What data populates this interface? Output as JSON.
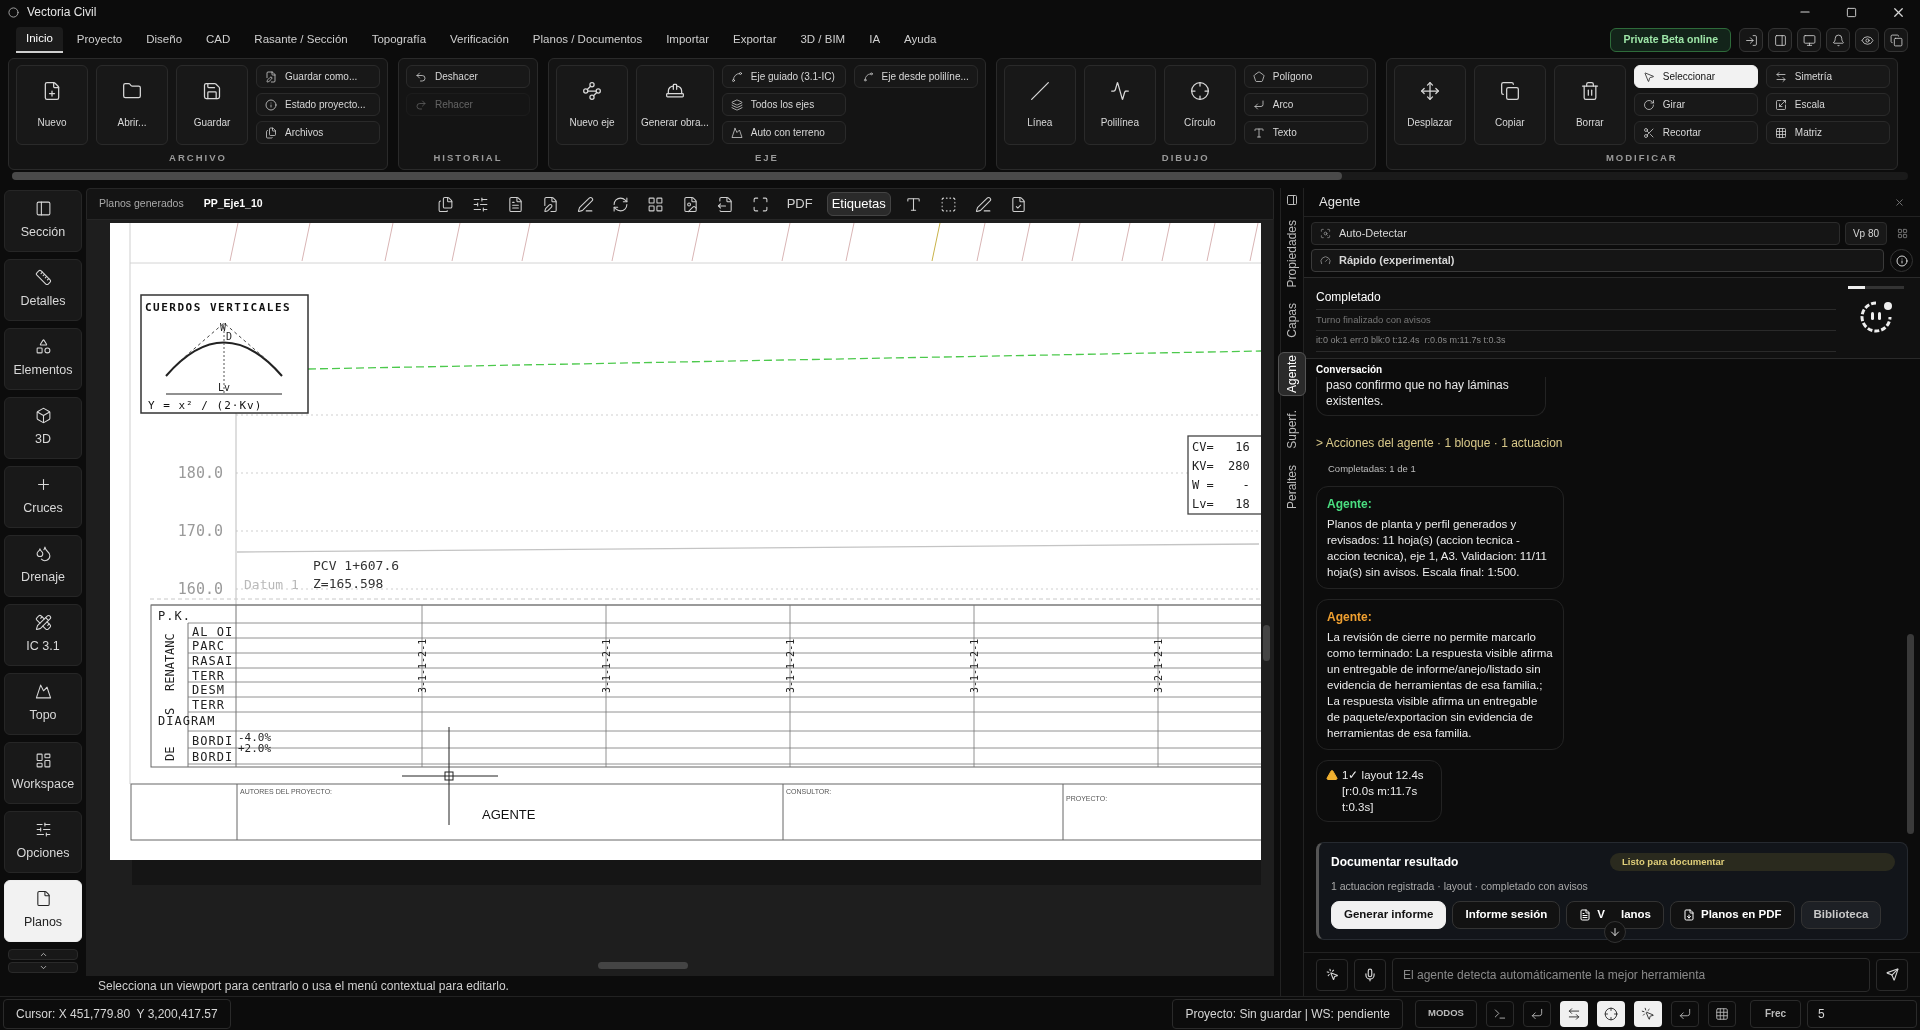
{
  "window": {
    "title": "Vectoria Civil"
  },
  "menu_tabs": [
    {
      "label": "Inicio",
      "selected": true
    },
    {
      "label": "Proyecto",
      "selected": false
    },
    {
      "label": "Diseño",
      "selected": false
    },
    {
      "label": "CAD",
      "selected": false
    },
    {
      "label": "Rasante / Sección",
      "selected": false
    },
    {
      "label": "Topografía",
      "selected": false
    },
    {
      "label": "Verificación",
      "selected": false
    },
    {
      "label": "Planos / Documentos",
      "selected": false
    },
    {
      "label": "Importar",
      "selected": false
    },
    {
      "label": "Exportar",
      "selected": false
    },
    {
      "label": "3D / BIM",
      "selected": false
    },
    {
      "label": "IA",
      "selected": false
    },
    {
      "label": "Ayuda",
      "selected": false
    }
  ],
  "status_badge": "Private Beta online",
  "ribbon": {
    "groups": [
      {
        "title": "ARCHIVO",
        "large": [
          {
            "label": "Nuevo"
          },
          {
            "label": "Abrir..."
          },
          {
            "label": "Guardar"
          }
        ],
        "small_columns": [
          [
            {
              "label": "Guardar como...",
              "disabled": false,
              "selected": false
            },
            {
              "label": "Estado proyecto...",
              "disabled": false,
              "selected": false
            },
            {
              "label": "Archivos",
              "disabled": false,
              "selected": false
            }
          ]
        ]
      },
      {
        "title": "HISTORIAL",
        "small_columns": [
          [
            {
              "label": "Deshacer",
              "disabled": false,
              "selected": false
            },
            {
              "label": "Rehacer",
              "disabled": true,
              "selected": false
            }
          ]
        ]
      },
      {
        "title": "EJE",
        "large": [
          {
            "label": "Nuevo eje"
          },
          {
            "label": "Generar obra..."
          }
        ],
        "small_columns": [
          [
            {
              "label": "Eje guiado (3.1-IC)",
              "disabled": false,
              "selected": false
            },
            {
              "label": "Todos los ejes",
              "disabled": false,
              "selected": false
            },
            {
              "label": "Auto con terreno",
              "disabled": false,
              "selected": false
            }
          ],
          [
            {
              "label": "Eje desde polilíne...",
              "disabled": false,
              "selected": false
            }
          ]
        ]
      },
      {
        "title": "DIBUJO",
        "large": [
          {
            "label": "Línea"
          },
          {
            "label": "Polilínea"
          },
          {
            "label": "Círculo"
          }
        ],
        "small_columns": [
          [
            {
              "label": "Polígono",
              "disabled": false,
              "selected": false
            },
            {
              "label": "Arco",
              "disabled": false,
              "selected": false
            },
            {
              "label": "Texto",
              "disabled": false,
              "selected": false
            }
          ]
        ]
      },
      {
        "title": "MODIFICAR",
        "large": [
          {
            "label": "Desplazar"
          },
          {
            "label": "Copiar"
          },
          {
            "label": "Borrar"
          }
        ],
        "small_columns": [
          [
            {
              "label": "Seleccionar",
              "disabled": false,
              "selected": true
            },
            {
              "label": "Girar",
              "disabled": false,
              "selected": false
            },
            {
              "label": "Recortar",
              "disabled": false,
              "selected": false
            }
          ],
          [
            {
              "label": "Simetría",
              "disabled": false,
              "selected": false
            },
            {
              "label": "Escala",
              "disabled": false,
              "selected": false
            },
            {
              "label": "Matriz",
              "disabled": false,
              "selected": false
            }
          ]
        ]
      }
    ]
  },
  "sidebar": {
    "items": [
      {
        "label": "Sección",
        "selected": false
      },
      {
        "label": "Detalles",
        "selected": false
      },
      {
        "label": "Elementos",
        "selected": false
      },
      {
        "label": "3D",
        "selected": false
      },
      {
        "label": "Cruces",
        "selected": false
      },
      {
        "label": "Drenaje",
        "selected": false
      },
      {
        "label": "IC 3.1",
        "selected": false
      },
      {
        "label": "Topo",
        "selected": false
      },
      {
        "label": "Workspace",
        "selected": false
      },
      {
        "label": "Opciones",
        "selected": false
      },
      {
        "label": "Planos",
        "selected": true
      }
    ]
  },
  "viewer": {
    "breadcrumb": "Planos generados",
    "sheet_name": "PP_Eje1_10",
    "text_buttons": [
      {
        "label": "PDF",
        "selected": false
      },
      {
        "label": "Etiquetas",
        "selected": true
      }
    ],
    "hint": "Selecciona un viewport para centrarlo o usa el menú contextual para editarlo."
  },
  "drawing": {
    "detail_box": {
      "title": "CUERDOS VERTICALES",
      "apex_label": "W",
      "offset_label": "D",
      "length_label": "Lv",
      "formula": "Y = x² / (2·Kv)"
    },
    "axis_labels": [
      "180.0",
      "170.0",
      "160.0"
    ],
    "datum": "Datum 1",
    "pcv": {
      "station": "PCV 1+607.6",
      "elevation": "Z=165.598"
    },
    "curve_data": [
      "CV=   16",
      "KV=  280",
      "W =    -",
      "Lv=   18"
    ],
    "band_groups": [
      "RENATANC",
      "S",
      "DE"
    ],
    "band_rows": [
      "P.K.",
      "AL OI",
      "PARC",
      "RASAI",
      "TERR",
      "DESM",
      "TERR",
      "DIAGRAM",
      "BORDI",
      "BORDI"
    ],
    "stations": [
      "3-1-1-2-1",
      "3-1-1-2-1",
      "3-1-1-2-1",
      "3-1-1-2-1",
      "3-2-1-2-1"
    ],
    "grades": [
      "-4.0%",
      "+2.0%"
    ],
    "title_block": {
      "authors_label": "AUTORES DEL PROYECTO:",
      "authors": "AGENTE",
      "consultant_label": "CONSULTOR:",
      "project_label": "PROYECTO:"
    }
  },
  "side_tabs": [
    {
      "label": "Propiedades",
      "selected": false
    },
    {
      "label": "Capas",
      "selected": false
    },
    {
      "label": "Agente",
      "selected": true
    },
    {
      "label": "Superf.",
      "selected": false
    },
    {
      "label": "Peraltes",
      "selected": false
    }
  ],
  "agent_panel": {
    "title": "Agente",
    "detector": "Auto-Detectar",
    "viewport_button": "Vp 80",
    "mode": "Rápido (experimental)",
    "run_status": {
      "title": "Completado",
      "subtitle": "Turno finalizado con avisos",
      "metrics": "it:0 ok:1 err:0 blk:0 t:12.4s  r:0.0s m:11.7s t:0.3s",
      "level": 0.3
    },
    "conversation_label": "Conversación",
    "messages": [
      {
        "kind": "text",
        "text": "paso confirmo que no hay láminas existentes."
      },
      {
        "kind": "actions",
        "text": "> Acciones del agente · 1 bloque · 1 actuacion"
      },
      {
        "kind": "note",
        "text": "Completadas: 1 de 1"
      },
      {
        "kind": "agent",
        "author": "Agente:",
        "color": "#4ade80",
        "text": "Planos de planta y perfil generados y revisados: 11 hoja(s) (accion tecnica - accion tecnica), eje 1, A3. Validacion: 11/11 hoja(s) sin avisos. Escala final: 1:500."
      },
      {
        "kind": "agent",
        "author": "Agente:",
        "color": "#f0a030",
        "text": "La revisión de cierre no permite marcarlo como terminado: La respuesta visible afirma un entregable de informe/anejo/listado sin evidencia de herramientas de esa familia.; La respuesta visible afirma un entregable de paquete/exportacion sin evidencia de herramientas de esa familia."
      },
      {
        "kind": "metrics",
        "text": "1✓ layout 12.4s [r:0.0s m:11.7s t:0.3s]"
      }
    ],
    "document_card": {
      "title": "Documentar resultado",
      "badge": "Listo para documentar",
      "summary": "1 actuacion registrada · layout · completado con avisos",
      "buttons": [
        {
          "label": "Generar informe",
          "kind": "primary"
        },
        {
          "label": "Informe sesión",
          "kind": "plain"
        },
        {
          "label": "V     lanos",
          "kind": "file"
        },
        {
          "label": "Planos en PDF",
          "kind": "pdf"
        },
        {
          "label": "Biblioteca",
          "kind": "muted"
        }
      ]
    },
    "input": {
      "placeholder": "El agente detecta automáticamente la mejor herramienta"
    }
  },
  "status_bar": {
    "cursor": "Cursor: X 451,779.80  Y 3,200,417.57",
    "project": "Proyecto: Sin guardar | WS: pendiente",
    "modes_button": "MODOS",
    "snap_toggles": [
      {
        "on": false
      },
      {
        "on": false
      },
      {
        "on": true
      },
      {
        "on": true
      },
      {
        "on": true
      },
      {
        "on": false
      },
      {
        "on": false
      }
    ],
    "frequency_label": "Frec",
    "frequency_value": "5"
  }
}
